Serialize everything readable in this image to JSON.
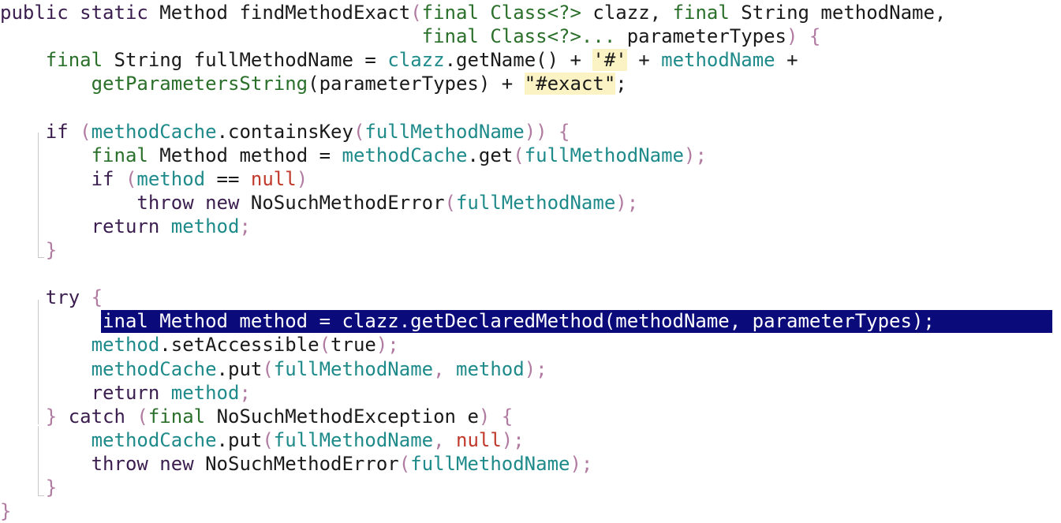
{
  "editor": {
    "lines": [
      {
        "tokens": [
          {
            "t": "public static ",
            "c": "kw"
          },
          {
            "t": "Method ",
            "c": "type"
          },
          {
            "t": "findMethodExact",
            "c": "plain"
          },
          {
            "t": "(",
            "c": "pale"
          },
          {
            "t": "final ",
            "c": "final"
          },
          {
            "t": "Class<?> ",
            "c": "call"
          },
          {
            "t": "clazz, ",
            "c": "plain"
          },
          {
            "t": "final ",
            "c": "final"
          },
          {
            "t": "String ",
            "c": "type"
          },
          {
            "t": "methodName,",
            "c": "plain"
          }
        ]
      },
      {
        "tokens": [
          {
            "t": "                                     final ",
            "c": "final"
          },
          {
            "t": "Class<?>... ",
            "c": "call"
          },
          {
            "t": "parameterTypes",
            "c": "plain"
          },
          {
            "t": ") {",
            "c": "pale"
          }
        ]
      },
      {
        "tokens": [
          {
            "t": "    final ",
            "c": "final"
          },
          {
            "t": "String ",
            "c": "type"
          },
          {
            "t": "fullMethodName ",
            "c": "plain"
          },
          {
            "t": "= ",
            "c": "op"
          },
          {
            "t": "clazz",
            "c": "var"
          },
          {
            "t": ".getName",
            "c": "plain"
          },
          {
            "t": "() + ",
            "c": "op"
          },
          {
            "t": "'#'",
            "c": "str",
            "hl": true
          },
          {
            "t": " + ",
            "c": "op"
          },
          {
            "t": "methodName",
            "c": "var"
          },
          {
            "t": " +",
            "c": "op"
          }
        ]
      },
      {
        "tokens": [
          {
            "t": "        getParametersString",
            "c": "call"
          },
          {
            "t": "(parameterTypes) + ",
            "c": "plain"
          },
          {
            "t": "\"#exact\"",
            "c": "str",
            "hl": true
          },
          {
            "t": ";",
            "c": "plain"
          }
        ]
      },
      {
        "tokens": []
      },
      {
        "tokens": [
          {
            "t": "    if ",
            "c": "kw"
          },
          {
            "t": "(",
            "c": "pale"
          },
          {
            "t": "methodCache",
            "c": "field"
          },
          {
            "t": ".containsKey",
            "c": "plain"
          },
          {
            "t": "(",
            "c": "pale"
          },
          {
            "t": "fullMethodName",
            "c": "local"
          },
          {
            "t": ")) {",
            "c": "pale"
          }
        ]
      },
      {
        "tokens": [
          {
            "t": "        final ",
            "c": "final"
          },
          {
            "t": "Method ",
            "c": "type"
          },
          {
            "t": "method ",
            "c": "plain"
          },
          {
            "t": "= ",
            "c": "op"
          },
          {
            "t": "methodCache",
            "c": "field"
          },
          {
            "t": ".get",
            "c": "plain"
          },
          {
            "t": "(",
            "c": "pale"
          },
          {
            "t": "fullMethodName",
            "c": "local"
          },
          {
            "t": ");",
            "c": "pale"
          }
        ]
      },
      {
        "tokens": [
          {
            "t": "        if ",
            "c": "kw"
          },
          {
            "t": "(",
            "c": "pale"
          },
          {
            "t": "method",
            "c": "local"
          },
          {
            "t": " == ",
            "c": "op"
          },
          {
            "t": "null",
            "c": "lit"
          },
          {
            "t": ")",
            "c": "pale"
          }
        ]
      },
      {
        "tokens": [
          {
            "t": "            throw new ",
            "c": "kw"
          },
          {
            "t": "NoSuchMethodError",
            "c": "type"
          },
          {
            "t": "(",
            "c": "pale"
          },
          {
            "t": "fullMethodName",
            "c": "local"
          },
          {
            "t": ");",
            "c": "pale"
          }
        ]
      },
      {
        "tokens": [
          {
            "t": "        return ",
            "c": "kw"
          },
          {
            "t": "method",
            "c": "local"
          },
          {
            "t": ";",
            "c": "pale"
          }
        ]
      },
      {
        "tokens": [
          {
            "t": "    }",
            "c": "pale"
          }
        ]
      },
      {
        "tokens": []
      },
      {
        "tokens": [
          {
            "t": "    try ",
            "c": "kw"
          },
          {
            "t": "{",
            "c": "pale"
          }
        ]
      },
      {
        "tokens": [
          {
            "t": "        final Method method = clazz.getDeclaredMethod(methodName, parameterTypes);",
            "c": "plain"
          }
        ],
        "selected": true
      },
      {
        "tokens": [
          {
            "t": "        method",
            "c": "local"
          },
          {
            "t": ".setAccessible",
            "c": "plain"
          },
          {
            "t": "(",
            "c": "pale"
          },
          {
            "t": "true",
            "c": "plain"
          },
          {
            "t": ");",
            "c": "pale"
          }
        ]
      },
      {
        "tokens": [
          {
            "t": "        methodCache",
            "c": "field"
          },
          {
            "t": ".put",
            "c": "plain"
          },
          {
            "t": "(",
            "c": "pale"
          },
          {
            "t": "fullMethodName",
            "c": "local"
          },
          {
            "t": ", ",
            "c": "pale"
          },
          {
            "t": "method",
            "c": "local"
          },
          {
            "t": ");",
            "c": "pale"
          }
        ]
      },
      {
        "tokens": [
          {
            "t": "        return ",
            "c": "kw"
          },
          {
            "t": "method",
            "c": "local"
          },
          {
            "t": ";",
            "c": "pale"
          }
        ]
      },
      {
        "tokens": [
          {
            "t": "    } ",
            "c": "pale"
          },
          {
            "t": "catch ",
            "c": "kw"
          },
          {
            "t": "(",
            "c": "pale"
          },
          {
            "t": "final ",
            "c": "final"
          },
          {
            "t": "NoSuchMethodException ",
            "c": "type"
          },
          {
            "t": "e",
            "c": "plain"
          },
          {
            "t": ") {",
            "c": "pale"
          }
        ]
      },
      {
        "tokens": [
          {
            "t": "        methodCache",
            "c": "field"
          },
          {
            "t": ".put",
            "c": "plain"
          },
          {
            "t": "(",
            "c": "pale"
          },
          {
            "t": "fullMethodName",
            "c": "local"
          },
          {
            "t": ", ",
            "c": "pale"
          },
          {
            "t": "null",
            "c": "lit"
          },
          {
            "t": ");",
            "c": "pale"
          }
        ]
      },
      {
        "tokens": [
          {
            "t": "        throw new ",
            "c": "kw"
          },
          {
            "t": "NoSuchMethodError",
            "c": "type"
          },
          {
            "t": "(",
            "c": "pale"
          },
          {
            "t": "fullMethodName",
            "c": "local"
          },
          {
            "t": ");",
            "c": "pale"
          }
        ]
      },
      {
        "tokens": [
          {
            "t": "    }",
            "c": "pale"
          }
        ]
      },
      {
        "tokens": [
          {
            "t": "}",
            "c": "pale"
          }
        ]
      }
    ]
  }
}
